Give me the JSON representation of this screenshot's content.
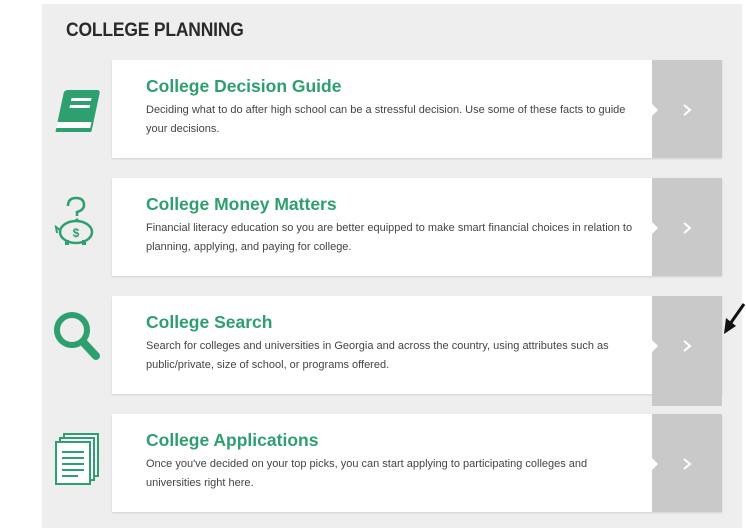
{
  "page": {
    "title": "COLLEGE PLANNING"
  },
  "colors": {
    "accent": "#2e9f6f",
    "arrow_bg": "#c9c9c9",
    "panel_bg": "#eeeeee"
  },
  "cards": [
    {
      "icon": "book-icon",
      "title": "College Decision Guide",
      "description": "Deciding what to do after high school can be a stressful decision. Use some of these facts to guide your decisions."
    },
    {
      "icon": "piggy-bank-icon",
      "title": "College Money Matters",
      "description": "Financial literacy education so you are better equipped to make smart financial choices in relation to planning, applying, and paying for college."
    },
    {
      "icon": "magnifier-icon",
      "title": "College Search",
      "description": "Search for colleges and universities in Georgia and across the country, using attributes such as public/private, size of school, or programs offered."
    },
    {
      "icon": "documents-icon",
      "title": "College Applications",
      "description": "Once you've decided on your top picks, you can start applying to participating colleges and universities right here."
    }
  ]
}
